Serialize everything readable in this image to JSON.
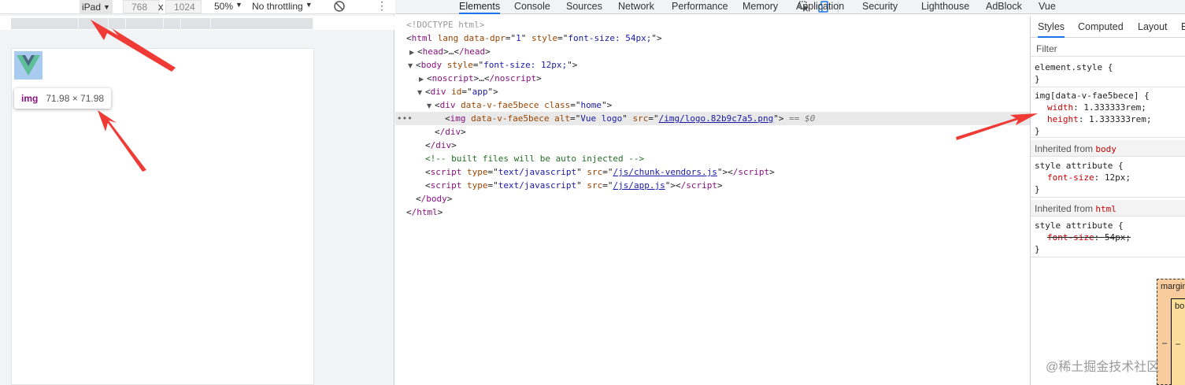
{
  "device_toolbar": {
    "device": "iPad",
    "width": "768",
    "times": "x",
    "height": "1024",
    "zoom": "50%",
    "throttling": "No throttling",
    "rotate_icon": "rotate-icon",
    "more_icon": "more-vert-icon"
  },
  "viewport": {
    "logo_icon": "vue-logo",
    "tooltip": {
      "tag": "img",
      "size": "71.98 × 71.98"
    }
  },
  "devtools": {
    "tabs": [
      "Elements",
      "Console",
      "Sources",
      "Network",
      "Performance",
      "Memory",
      "Application",
      "Security",
      "Lighthouse",
      "AdBlock",
      "Vue"
    ],
    "active_tab": "Elements"
  },
  "elements_tree": {
    "doctype": "<!DOCTYPE html>",
    "html_open": {
      "tag": "html",
      "attr1": "lang",
      "attr2": "data-dpr",
      "val2": "1",
      "attr3": "style",
      "val3": "font-size: 54px;"
    },
    "head": {
      "tag": "head",
      "ellipsis": "…",
      "close": "/head"
    },
    "body_open": {
      "tag": "body",
      "attr": "style",
      "val": "font-size: 12px;"
    },
    "noscript": {
      "tag": "noscript",
      "ellipsis": "…",
      "close": "/noscript"
    },
    "div_app": {
      "tag": "div",
      "attr": "id",
      "val": "app"
    },
    "div_home": {
      "tag": "div",
      "attr1": "data-v-fae5bece",
      "attr2": "class",
      "val2": "home"
    },
    "img": {
      "tag": "img",
      "attr1": "data-v-fae5bece",
      "attr2": "alt",
      "val2": "Vue logo",
      "attr3": "src",
      "val3": "/img/logo.82b9c7a5.png",
      "eq": "== $0"
    },
    "div_close": "/div",
    "comment": "<!-- built files will be auto injected -->",
    "script1": {
      "tag": "script",
      "attr1": "type",
      "val1": "text/javascript",
      "attr2": "src",
      "val2": "/js/chunk-vendors.js",
      "close": "/script"
    },
    "script2": {
      "tag": "script",
      "attr1": "type",
      "val1": "text/javascript",
      "attr2": "src",
      "val2": "/js/app.js",
      "close": "/script"
    },
    "body_close": "/body",
    "html_close": "/html"
  },
  "styles": {
    "subtabs": [
      "Styles",
      "Computed",
      "Layout",
      "E"
    ],
    "filter_placeholder": "Filter",
    "element_style": {
      "selector": "element.style {",
      "close": "}"
    },
    "img_rule": {
      "selector": "img[data-v-fae5bece] {",
      "width_name": "width",
      "width_value": "1.333333rem;",
      "height_name": "height",
      "height_value": "1.333333rem;",
      "close": "}"
    },
    "inherited_body": {
      "label": "Inherited from",
      "tag": "body"
    },
    "body_rule": {
      "selector": "style attribute {",
      "prop_name": "font-size",
      "prop_value": "12px;",
      "close": "}"
    },
    "inherited_html": {
      "label": "Inherited from",
      "tag": "html"
    },
    "html_rule": {
      "selector": "style attribute {",
      "prop_name": "font-size",
      "prop_value": "54px;",
      "close": "}"
    },
    "box_model": {
      "margin": "margin",
      "border": "bo",
      "dash": "–"
    }
  },
  "watermark": "@稀土掘金技术社区",
  "annotation_color": "#ef3a35"
}
